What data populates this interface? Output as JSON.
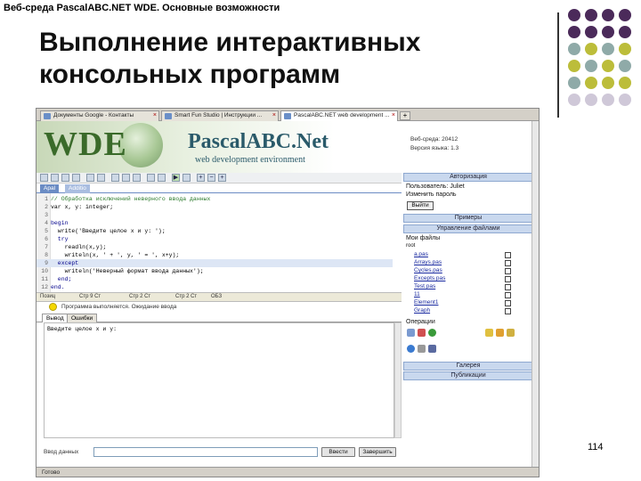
{
  "slide": {
    "header": "Веб-среда PascalABC.NET WDE. Основные возможности",
    "title_line1": "Выполнение интерактивных",
    "title_line2": "консольных программ",
    "page_number": "114"
  },
  "colors": {
    "purple": "#4b2a5a",
    "teal": "#8faaa8",
    "olive": "#bcbd3a",
    "lavender": "#cfc8d8"
  },
  "browser": {
    "tabs": [
      {
        "label": "Документы Google - Контакты",
        "icon": "page-icon"
      },
      {
        "label": "Smart Fun Studio | Инструкции ...",
        "icon": "page-icon"
      },
      {
        "label": "PascalABC.NET web development ...",
        "icon": "page-icon"
      }
    ],
    "new_tab": "+",
    "bottom_status": "Готово"
  },
  "banner": {
    "logo": "WDE",
    "product": "PascalABC.Net",
    "subtitle": "web development environment",
    "version": "Веб-среда: 20412\nВерсия языка: 1.3"
  },
  "editor": {
    "tabs": [
      "Apal",
      "Additio"
    ],
    "lines": [
      {
        "n": "1",
        "text": "// Обработка исключений неверного ввода данных",
        "cls": "comment"
      },
      {
        "n": "2",
        "text": "var x, y: integer;",
        "cls": ""
      },
      {
        "n": "3",
        "text": "",
        "cls": ""
      },
      {
        "n": "4",
        "text": "begin",
        "cls": "kw"
      },
      {
        "n": "5",
        "text": "  write('Введите целое x и y: ');",
        "cls": ""
      },
      {
        "n": "6",
        "text": "  try",
        "cls": "kw"
      },
      {
        "n": "7",
        "text": "    readln(x,y);",
        "cls": ""
      },
      {
        "n": "8",
        "text": "    writeln(x, ' + ', y, ' = ', x+y);",
        "cls": ""
      },
      {
        "n": "9",
        "text": "  except",
        "cls": "kw"
      },
      {
        "n": "10",
        "text": "    writeln('Неверный формат ввода данных');",
        "cls": ""
      },
      {
        "n": "11",
        "text": "  end;",
        "cls": "kw"
      },
      {
        "n": "12",
        "text": "end.",
        "cls": "kw"
      }
    ],
    "status": [
      "Позиц",
      "Стр 9 Ст",
      "Стр 2 Ст",
      "Стр 2 Ст",
      "ОБЗ"
    ],
    "message": "Программа выполняется. Ожидание ввода",
    "io_tabs": [
      "Вывод",
      "Ошибки"
    ],
    "output": "Введите целое x и y: ",
    "input_label": "Ввод данных",
    "input_value": "",
    "enter_button": "Ввести",
    "stop_button": "Завершить"
  },
  "right_panel": {
    "auth_header": "Авторизация",
    "user_label": "Пользователь: Juliet",
    "change_user": "Изменить пароль",
    "login_button": "Выйти",
    "examples_header": "Примеры",
    "files_header": "Управление файлами",
    "my_files": "Мои файлы",
    "root": "root",
    "files": [
      "a.pas",
      "Arrays.pas",
      "Cycles.pas",
      "Excepts.pas",
      "Test.pas",
      "11",
      "Element1",
      "Graph"
    ],
    "operations": "Операции",
    "gallery_header": "Галерея",
    "publish_header": "Публикации"
  }
}
